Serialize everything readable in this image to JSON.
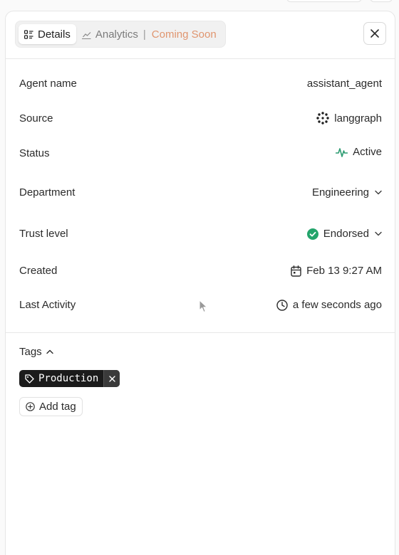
{
  "tabs": {
    "details_label": "Details",
    "analytics_label": "Analytics",
    "separator": "|",
    "coming_soon_label": "Coming Soon"
  },
  "details": {
    "agent_name": {
      "label": "Agent name",
      "value": "assistant_agent"
    },
    "source": {
      "label": "Source",
      "value": "langgraph",
      "icon": "langgraph-logo-icon"
    },
    "status": {
      "label": "Status",
      "value": "Active",
      "icon": "activity-pulse-icon",
      "color": "#2e9c72"
    },
    "department": {
      "label": "Department",
      "value": "Engineering"
    },
    "trust_level": {
      "label": "Trust level",
      "value": "Endorsed",
      "icon": "check-circle-icon",
      "color": "#23a46b"
    },
    "created": {
      "label": "Created",
      "value": "Feb 13 9:27 AM",
      "icon": "calendar-icon"
    },
    "last_activity": {
      "label": "Last Activity",
      "value": "a few seconds ago",
      "icon": "clock-icon"
    }
  },
  "tags": {
    "heading": "Tags",
    "items": [
      {
        "label": "Production"
      }
    ],
    "add_label": "Add tag"
  }
}
